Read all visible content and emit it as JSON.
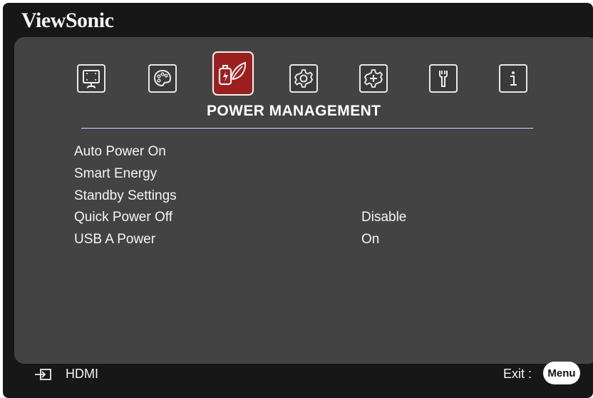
{
  "brand": "ViewSonic",
  "tabs": [
    {
      "icon": "display-icon",
      "active": false
    },
    {
      "icon": "palette-icon",
      "active": false
    },
    {
      "icon": "power-leaf-icon",
      "active": true
    },
    {
      "icon": "gear-icon",
      "active": false
    },
    {
      "icon": "advanced-gear-icon",
      "active": false
    },
    {
      "icon": "wrench-icon",
      "active": false
    },
    {
      "icon": "info-icon",
      "active": false
    }
  ],
  "section_title": "POWER MANAGEMENT",
  "menu": {
    "items": [
      {
        "label": "Auto Power On",
        "value": ""
      },
      {
        "label": "Smart Energy",
        "value": ""
      },
      {
        "label": "Standby Settings",
        "value": ""
      },
      {
        "label": "Quick Power Off",
        "value": "Disable"
      },
      {
        "label": "USB A Power",
        "value": "On"
      }
    ]
  },
  "footer": {
    "source": "HDMI",
    "source_icon": "input-source-icon",
    "exit_label": "Exit :",
    "menu_button": "Menu"
  },
  "colors": {
    "active_tab": "#9c1f1f",
    "panel": "#434343",
    "divider": "#8e9ab8"
  }
}
